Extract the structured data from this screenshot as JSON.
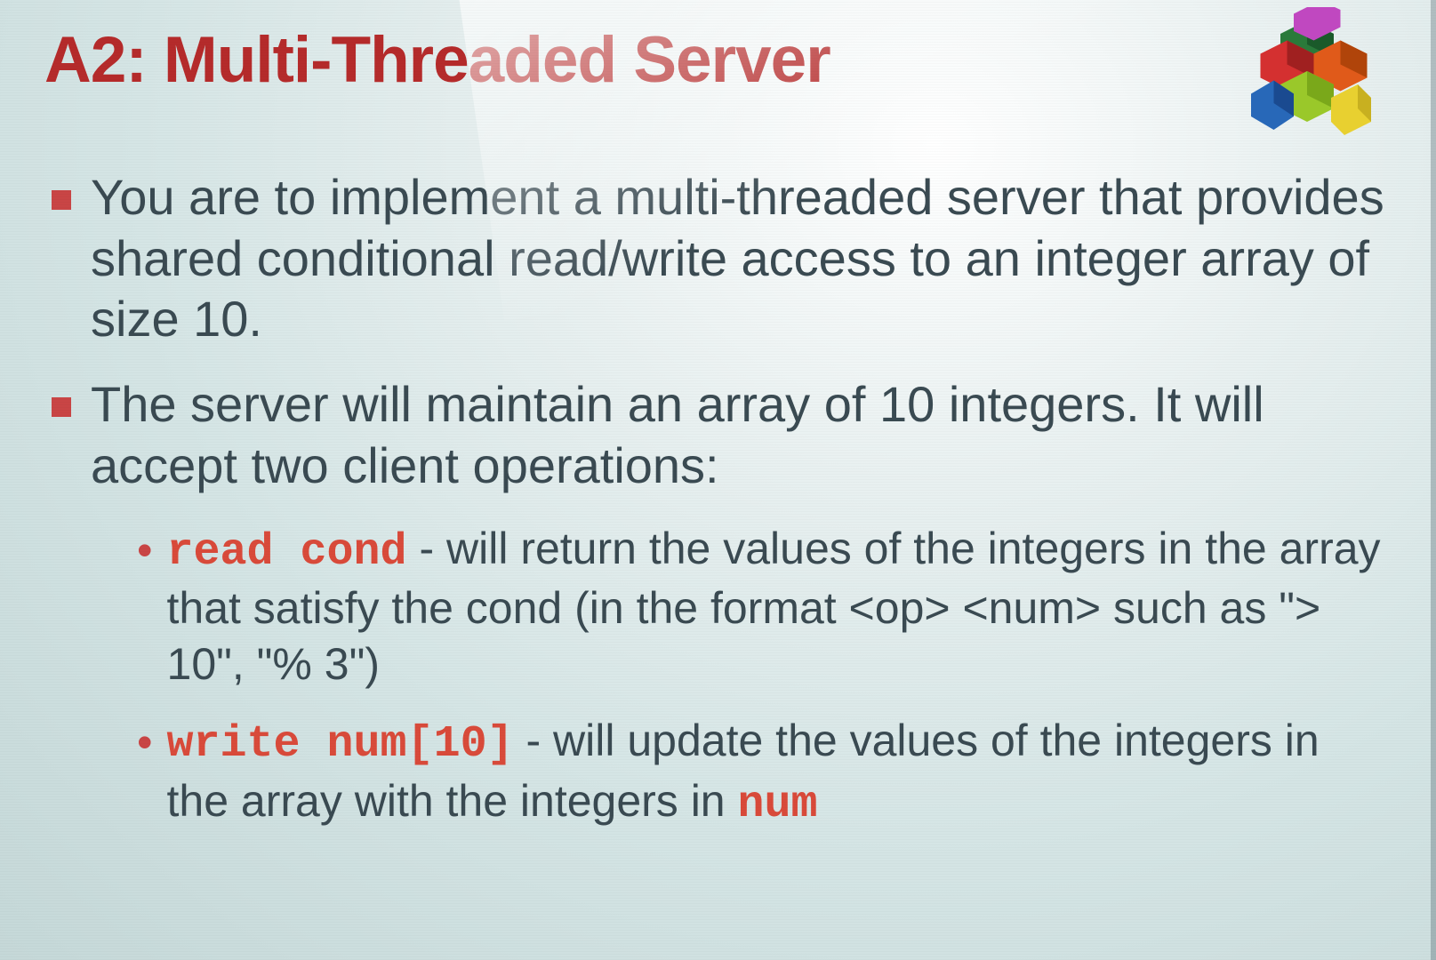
{
  "title": "A2: Multi-Threaded Server",
  "bullets": [
    {
      "text": "You are to implement a multi-threaded server that provides shared conditional read/write access to an integer array of size 10."
    },
    {
      "text": "The server will maintain an array of 10 integers. It will accept two client operations:"
    }
  ],
  "sub": [
    {
      "code1": "read cond",
      "rest": " - will return the values of the integers in the array that satisfy the cond (in the format <op> <num> such as \"> 10\", \"% 3\")"
    },
    {
      "code1": "write num[10]",
      "rest1": " - will update the values of the integers in the array with the integers in ",
      "code2": "num"
    }
  ]
}
